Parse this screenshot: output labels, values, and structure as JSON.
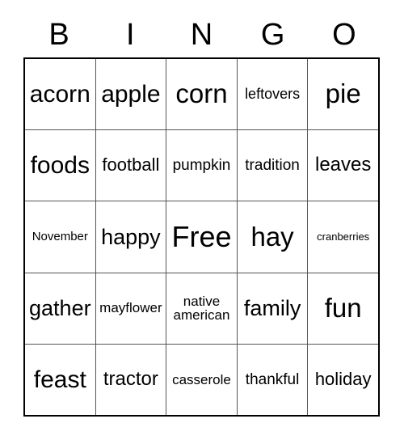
{
  "card": {
    "header": {
      "letters": [
        "B",
        "I",
        "N",
        "G",
        "O"
      ]
    },
    "colors": {
      "background": "#ffffff",
      "text": "#000000",
      "outer_border": "#000000",
      "inner_grid_line": "#555555"
    },
    "grid": {
      "columns": 5,
      "rows": 5,
      "cells": [
        [
          {
            "text": "acorn",
            "size": "fs-30"
          },
          {
            "text": "apple",
            "size": "fs-30"
          },
          {
            "text": "corn",
            "size": "fs-33"
          },
          {
            "text": "leftovers",
            "size": "fs-18"
          },
          {
            "text": "pie",
            "size": "fs-33"
          }
        ],
        [
          {
            "text": "foods",
            "size": "fs-30"
          },
          {
            "text": "football",
            "size": "fs-22"
          },
          {
            "text": "pumpkin",
            "size": "fs-19"
          },
          {
            "text": "tradition",
            "size": "fs-19"
          },
          {
            "text": "leaves",
            "size": "fs-24"
          }
        ],
        [
          {
            "text": "November",
            "size": "fs-15"
          },
          {
            "text": "happy",
            "size": "fs-27"
          },
          {
            "text": "Free",
            "size": "fs-36"
          },
          {
            "text": "hay",
            "size": "fs-33"
          },
          {
            "text": "cranberries",
            "size": "fs-13"
          }
        ],
        [
          {
            "text": "gather",
            "size": "fs-27"
          },
          {
            "text": "mayflower",
            "size": "fs-17"
          },
          {
            "text": "native\namerican",
            "size": "fs-17"
          },
          {
            "text": "family",
            "size": "fs-27"
          },
          {
            "text": "fun",
            "size": "fs-33"
          }
        ],
        [
          {
            "text": "feast",
            "size": "fs-30"
          },
          {
            "text": "tractor",
            "size": "fs-24"
          },
          {
            "text": "casserole",
            "size": "fs-17"
          },
          {
            "text": "thankful",
            "size": "fs-19"
          },
          {
            "text": "holiday",
            "size": "fs-22"
          }
        ]
      ]
    }
  }
}
